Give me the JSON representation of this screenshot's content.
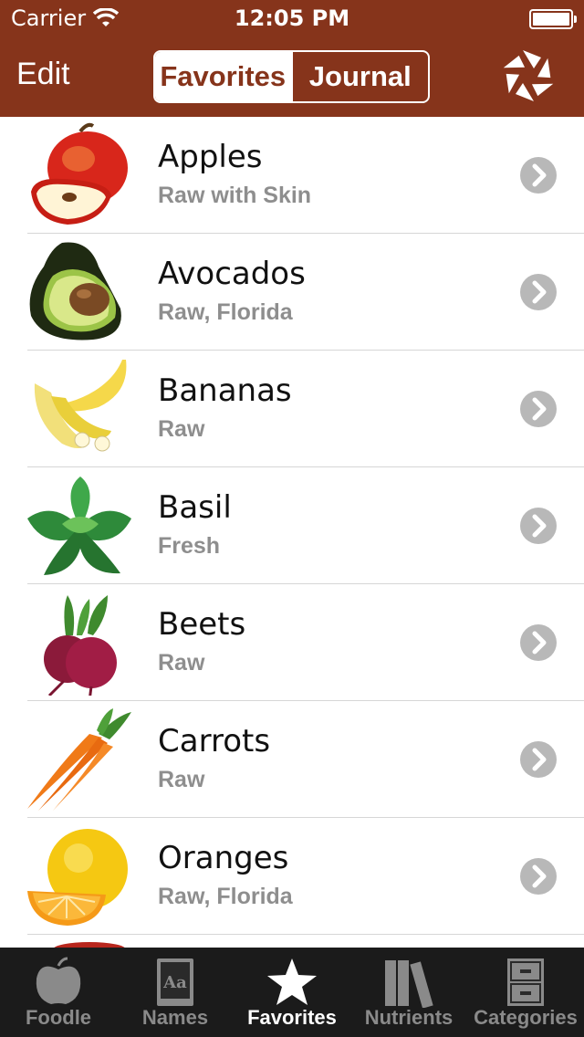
{
  "status_bar": {
    "carrier": "Carrier",
    "time": "12:05 PM"
  },
  "nav": {
    "edit_label": "Edit",
    "segments": [
      {
        "label": "Favorites",
        "selected": true
      },
      {
        "label": "Journal",
        "selected": false
      }
    ],
    "logo_icon": "aperture-logo-icon"
  },
  "foods": [
    {
      "name": "Apples",
      "detail": "Raw with Skin",
      "icon": "apple-icon"
    },
    {
      "name": "Avocados",
      "detail": "Raw, Florida",
      "icon": "avocado-icon"
    },
    {
      "name": "Bananas",
      "detail": "Raw",
      "icon": "banana-icon"
    },
    {
      "name": "Basil",
      "detail": "Fresh",
      "icon": "basil-icon"
    },
    {
      "name": "Beets",
      "detail": "Raw",
      "icon": "beet-icon"
    },
    {
      "name": "Carrots",
      "detail": "Raw",
      "icon": "carrot-icon"
    },
    {
      "name": "Oranges",
      "detail": "Raw, Florida",
      "icon": "orange-icon"
    }
  ],
  "tabbar": {
    "tabs": [
      {
        "label": "Foodle",
        "icon": "apple-tab-icon",
        "active": false
      },
      {
        "label": "Names",
        "icon": "dictionary-icon",
        "active": false
      },
      {
        "label": "Favorites",
        "icon": "star-icon",
        "active": true
      },
      {
        "label": "Nutrients",
        "icon": "books-icon",
        "active": false
      },
      {
        "label": "Categories",
        "icon": "cabinet-icon",
        "active": false
      }
    ]
  },
  "colors": {
    "header": "#86341b",
    "tabbar": "#1b1b1b",
    "chevron": "#b8b8b8",
    "subtitle": "#8e8e8e"
  }
}
